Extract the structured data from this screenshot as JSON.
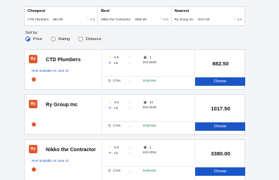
{
  "summary": [
    {
      "title": "Cheapest",
      "name": "CTD Plumbers",
      "price": "882.50",
      "rating": "4.5"
    },
    {
      "title": "Best",
      "name": "Nikko the Contractor",
      "price": "3380.00",
      "rating": "5.0"
    },
    {
      "title": "Nearest",
      "name": "Ry Group Inc",
      "price": "1017.50",
      "rating": "4.8"
    }
  ],
  "sort": {
    "label": "Sort by:",
    "options": [
      "Price",
      "Rating",
      "Distance"
    ],
    "selected": "Price"
  },
  "cards": [
    {
      "logo_text": "Ry",
      "name": "CTD Plumbers",
      "next_available": "Next available on June 21",
      "rating": "4.5",
      "level": "L5",
      "count": "1",
      "est": "Est 2020",
      "time": "2 hrs",
      "estimate_label": "Estimate",
      "price": "882.50",
      "choose_label": "Choose"
    },
    {
      "logo_text": "Ry",
      "name": "Ry Group Inc",
      "next_available": "",
      "rating": "4.8",
      "level": "L5",
      "count": "12",
      "est": "Est 2020",
      "time": "2 hrs",
      "estimate_label": "Estimate",
      "price": "1017.50",
      "choose_label": "Choose"
    },
    {
      "logo_text": "Ry",
      "name": "Nikko the Contractor",
      "next_available": "Next available on June 21",
      "rating": "5.0",
      "level": "L5",
      "count": "1",
      "est": "Est 2024",
      "time": "2 hrs",
      "estimate_label": "Estimate",
      "price": "3380.00",
      "choose_label": "Choose"
    }
  ],
  "colors": {
    "accent": "#1a56c7",
    "brand": "#e0582e",
    "estimate": "#1e8a4c",
    "star": "#e8a317"
  }
}
